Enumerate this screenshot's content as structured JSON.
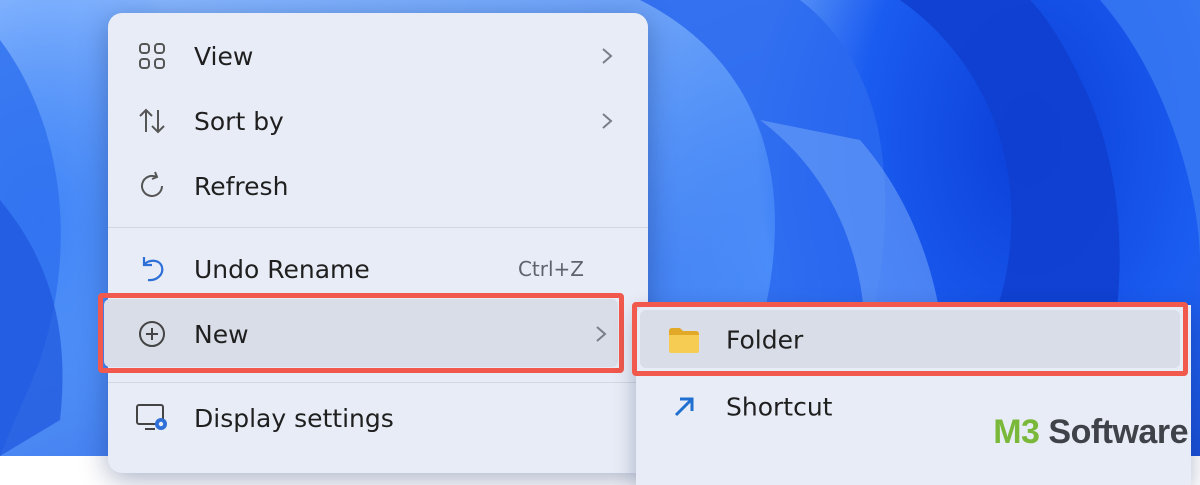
{
  "context_menu": {
    "items": [
      {
        "label": "View",
        "icon": "grid-icon",
        "has_submenu": true
      },
      {
        "label": "Sort by",
        "icon": "sort-arrows-icon",
        "has_submenu": true
      },
      {
        "label": "Refresh",
        "icon": "refresh-icon",
        "has_submenu": false
      },
      {
        "label": "Undo Rename",
        "icon": "undo-icon",
        "shortcut": "Ctrl+Z"
      },
      {
        "label": "New",
        "icon": "plus-circle-icon",
        "has_submenu": true,
        "highlighted": true
      },
      {
        "label": "Display settings",
        "icon": "display-settings-icon",
        "has_submenu": false
      }
    ]
  },
  "new_submenu": {
    "items": [
      {
        "label": "Folder",
        "icon": "folder-icon",
        "highlighted": true
      },
      {
        "label": "Shortcut",
        "icon": "shortcut-arrow-icon"
      }
    ]
  },
  "watermark": {
    "prefix": "M3",
    "suffix": " Software"
  },
  "colors": {
    "highlight_border": "#f0594b",
    "menu_background": "#e8ecf6",
    "folder_yellow": "#f3c746",
    "watermark_green": "#7ab83a"
  }
}
